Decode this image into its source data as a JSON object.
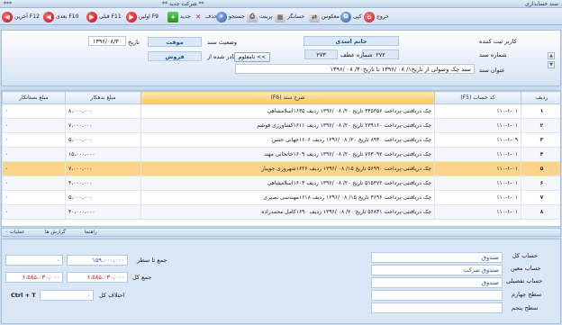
{
  "titlebar": {
    "title": "سند حسابداری",
    "company": "** شرکت جدید **",
    "extra": "***"
  },
  "toolbar": {
    "buttons": [
      {
        "label": "آخرین F12",
        "icon": "last-record-icon",
        "glyph": "◀"
      },
      {
        "label": "بعدی F10",
        "icon": "next-record-icon",
        "glyph": "◀"
      },
      {
        "label": "قبلی F11",
        "icon": "previous-record-icon",
        "glyph": "▶"
      },
      {
        "label": "اولین F9",
        "icon": "first-record-icon",
        "glyph": "▶"
      },
      {
        "label": "جدید",
        "icon": "new-icon",
        "glyph": "+"
      },
      {
        "label": "حذف",
        "icon": "delete-icon",
        "glyph": "✕"
      },
      {
        "label": "جستجو",
        "icon": "search-icon",
        "glyph": "⌕"
      },
      {
        "label": "پرینت",
        "icon": "print-icon",
        "glyph": "⎙"
      },
      {
        "label": "حسابگر",
        "icon": "calculator-icon",
        "glyph": "▦"
      },
      {
        "label": "معکوس",
        "icon": "reverse-icon",
        "glyph": "⇄"
      },
      {
        "label": "کپی",
        "icon": "copy-icon",
        "glyph": "⧉"
      },
      {
        "label": "خروج",
        "icon": "exit-icon",
        "glyph": "⌂"
      }
    ]
  },
  "header": {
    "registrar_label": "کاربر ثبت کننده",
    "registrar_value": "خانم اسدی",
    "docnum_label": "شماره سند",
    "docnum_value": "۲۷۲",
    "atf_label": "شماره عطف",
    "atf_value": "۲۷۳",
    "desc_label": "عنوان سند",
    "desc_value": "سند چک وصولی از تاریخ۱/ ۰۸ /۱۳۹۶ تا تاریخ۳۰/ ۰۸ /۱۳۹۶",
    "status_label": "وضعیت سند",
    "status_value": "موقت",
    "issued_label": "صادر شده از",
    "issued_value": "فروش",
    "date_label": "تاریخ",
    "date_value": "۱۳۹۶/۰۸/۳۰",
    "unknown_button": "نامعلوم <<"
  },
  "grid": {
    "columns": [
      "ردیف",
      "کد حساب (F5)",
      "شرح سند (F6)",
      "مبلغ بدهکار",
      "مبلغ بستانکار"
    ],
    "rows": [
      {
        "n": "۱",
        "code": "۱۱۰-۱-۰۱",
        "desc": "چک دریافتنی-پرداخت   ۴۴۵۳۵۶ تاریخ ۲۰/ ۰۸ /۱۳۹۶ ردیف ۱۶۳۵اسلامشاهی",
        "debit": "۸،۰۰۰،۰۰۰",
        "credit": "۰"
      },
      {
        "n": "۲",
        "code": "۱۱۰-۱-۰۱",
        "desc": "چک دریافتنی-پرداخت   ۲۳۹۱۶۰ تاریخ ۲۰/ ۰۸ /۱۳۹۶ ردیف ۱۶۱۱کشاورزی قوشم",
        "debit": "۷،۰۰۰،۰۰۰",
        "credit": "۰"
      },
      {
        "n": "۳",
        "code": "۱۱۰-۱-۰۹",
        "desc": "چک دریافتنی-پرداخت   ۸۹۴۰ تاریخ ۲۰/ ۰۸ /۱۳۹۶ ردیف ۱۶۰۶جهانی حسن",
        "debit": "۵،۰۰۰،۰۰۰",
        "credit": "۰"
      },
      {
        "n": "۴",
        "code": "۱۱۰-۱-۰۱",
        "desc": "چک دریافتنی-پرداخت   ۷۶۳۰۹۲ تاریخ ۲۰/ ۰۸ /۱۳۹۶ ردیف ۱۶۰۹خانجانی مهند",
        "debit": "۱۵،۰۰۰،۰۰۰",
        "credit": "۰"
      },
      {
        "n": "۵",
        "code": "۱۱۰-۱-۰۱",
        "desc": "چک دریافتنی-پرداخت   ۵۶۹۹۰ تاریخ ۱۵/ ۰۸ /۱۳۹۶ ردیف ۱۶۲۶شهروزی جویبار",
        "debit": "۷،۰۰۰،۰۰۰",
        "credit": "۰"
      },
      {
        "n": "۶",
        "code": "۱۱۰-۱-۰۱",
        "desc": "چک دریافتنی-پرداخت   ۵۱۵۳۷۲ تاریخ ۲۰/ ۰۸ /۱۳۹۶ ردیف ۱۶۰۴اسلامشاهی",
        "debit": "۴،۰۰۰،۰۰۰",
        "credit": "۰"
      },
      {
        "n": "۷",
        "code": "۱۱۰-۱-۰۱",
        "desc": "چک دریافتنی-پرداخت   ۴۶۹۶ تاریخ ۱۵/ ۰۸ /۱۳۹۶ ردیف ۱۶۱۸مهندسی نصیری",
        "debit": "۵،۰۰۰،۰۰۰",
        "credit": "۰"
      },
      {
        "n": "۸",
        "code": "۱۱۰-۱-۰۱",
        "desc": "چک دریافتنی-پرداخت   ۵۶۸۴۱ تاریخ ۲۰/ ۰۸ /۱۳۹۶ ردیف ۱۶۹۰کامل محمدزاده",
        "debit": "۳۰،۰۰۰،۰۰۰",
        "credit": "۰"
      }
    ]
  },
  "statusbar": {
    "operations": "۰ عملیات",
    "reports": "گزارش ها",
    "guide": "راهنما"
  },
  "bottom": {
    "total_label": "جمع تا سطر",
    "total_debit": "۱۵۹،۰۰۰،۰۰۰",
    "total_credit": "۰",
    "sum_label": "جمع کل",
    "sum_debit": "۶،۵۸۵،۰۳۰،۰۰۰",
    "sum_credit": "۶،۵۸۵،۰۳۰،۰۰۰",
    "diff_label": "اختلاف کل",
    "diff_value": "۰",
    "shortcut": "Ctrl + T",
    "account_labels": [
      "حساب کل",
      "حساب معین",
      "حساب تفصیلی",
      "سطح چهارم",
      "سطح پنجم"
    ],
    "account_values": [
      "صندوق",
      "صندوق شرکت",
      "صندوق",
      "",
      ""
    ]
  }
}
